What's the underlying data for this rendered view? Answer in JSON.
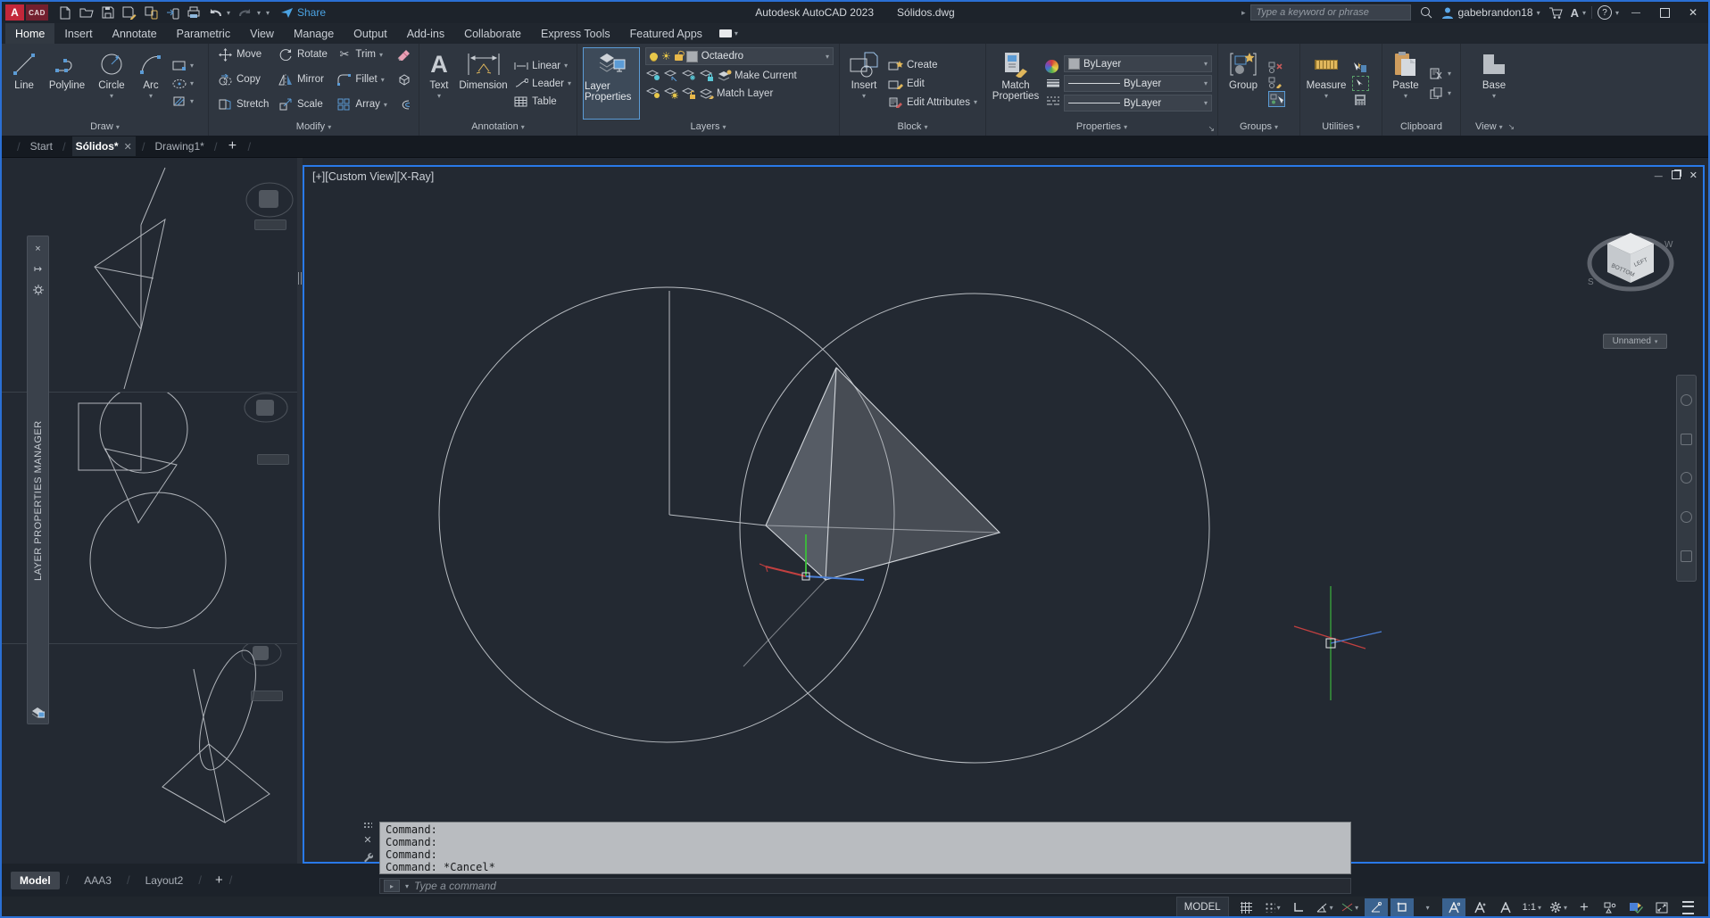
{
  "titlebar": {
    "logo_a": "A",
    "logo_cad": "CAD",
    "app_title": "Autodesk AutoCAD 2023",
    "doc_title": "Sólidos.dwg",
    "share_label": "Share",
    "search_placeholder": "Type a keyword or phrase",
    "username": "gabebrandon18",
    "autodesk_menu": "A",
    "help_glyph": "?"
  },
  "ribbon_tabs": [
    "Home",
    "Insert",
    "Annotate",
    "Parametric",
    "View",
    "Manage",
    "Output",
    "Add-ins",
    "Collaborate",
    "Express Tools",
    "Featured Apps"
  ],
  "panels": {
    "draw": {
      "label": "Draw",
      "line": "Line",
      "polyline": "Polyline",
      "circle": "Circle",
      "arc": "Arc"
    },
    "modify": {
      "label": "Modify",
      "move": "Move",
      "rotate": "Rotate",
      "trim": "Trim",
      "copy": "Copy",
      "mirror": "Mirror",
      "fillet": "Fillet",
      "stretch": "Stretch",
      "scale": "Scale",
      "array": "Array"
    },
    "annotation": {
      "label": "Annotation",
      "text": "Text",
      "dimension": "Dimension",
      "linear": "Linear",
      "leader": "Leader",
      "table": "Table"
    },
    "layers": {
      "label": "Layers",
      "layer_properties": "Layer Properties",
      "current_layer": "Octaedro",
      "make_current": "Make Current",
      "match_layer": "Match Layer"
    },
    "block": {
      "label": "Block",
      "insert": "Insert",
      "create": "Create",
      "edit": "Edit",
      "edit_attributes": "Edit Attributes"
    },
    "properties": {
      "label": "Properties",
      "match_properties": "Match Properties",
      "color": "ByLayer",
      "lineweight": "ByLayer",
      "linetype": "ByLayer"
    },
    "groups": {
      "label": "Groups",
      "group": "Group"
    },
    "utilities": {
      "label": "Utilities",
      "measure": "Measure"
    },
    "clipboard": {
      "label": "Clipboard",
      "paste": "Paste"
    },
    "view": {
      "label": "View",
      "base": "Base"
    }
  },
  "file_tabs": {
    "start": "Start",
    "active": "Sólidos*",
    "other": "Drawing1*"
  },
  "viewport": {
    "label": "[+][Custom View][X-Ray]",
    "view_pill": "Unnamed",
    "cube_face_a": "BOTTOM",
    "cube_face_b": "LEFT",
    "compass_s": "S",
    "compass_w": "W"
  },
  "palette": {
    "title": "LAYER PROPERTIES MANAGER"
  },
  "command": {
    "lines": [
      "Command:",
      "Command:",
      "Command:",
      "Command: *Cancel*"
    ],
    "prompt": "Type a command"
  },
  "layout_tabs": {
    "model": "Model",
    "tab2": "AAA3",
    "tab3": "Layout2"
  },
  "statusbar": {
    "model": "MODEL",
    "scale": "1:1"
  }
}
